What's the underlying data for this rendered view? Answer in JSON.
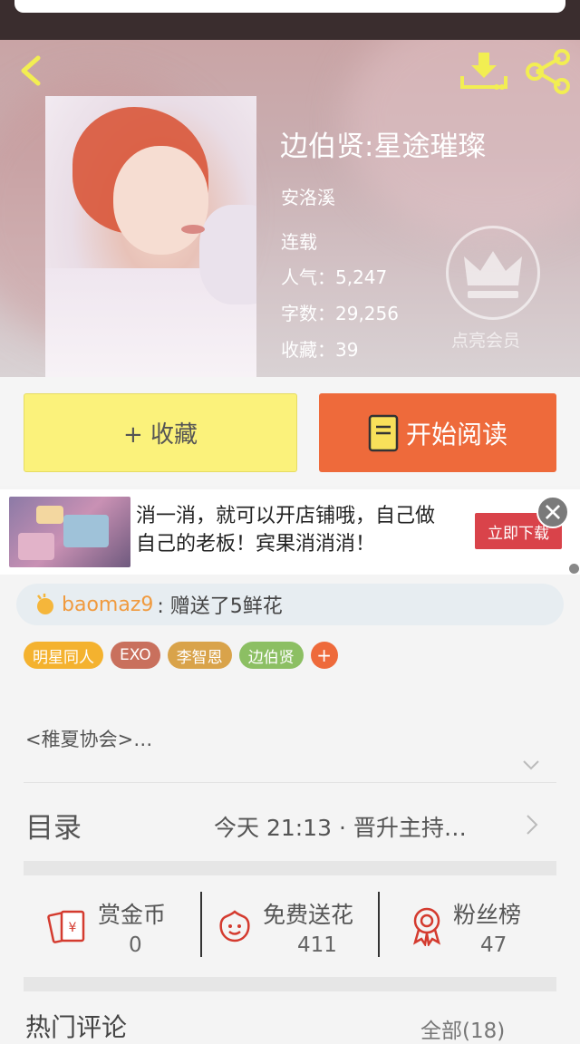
{
  "book": {
    "title": "边伯贤:星途璀璨",
    "author": "安洛溪",
    "status": "连载",
    "popularity_label": "人气：",
    "popularity": "5,247",
    "words_label": "字数：",
    "words": "29,256",
    "favorites_label": "收藏：",
    "favorites": "39"
  },
  "vip": {
    "label": "点亮会员"
  },
  "actions": {
    "collect": "+ 收藏",
    "read": "开始阅读"
  },
  "ad": {
    "text": "消一消，就可以开店铺哦，自己做自己的老板！宾果消消消！",
    "cta": "立即下载"
  },
  "gift": {
    "user": "baomaz9",
    "text": ": 赠送了5鲜花"
  },
  "tags": [
    {
      "label": "明星同人",
      "color": "#f4b22f"
    },
    {
      "label": "EXO",
      "color": "#c9705d"
    },
    {
      "label": "李智恩",
      "color": "#d9a34a"
    },
    {
      "label": "边伯贤",
      "color": "#8cbf63"
    },
    {
      "label": "+",
      "color": "#ee6a3b"
    }
  ],
  "intro": "<稚夏协会>…",
  "toc": {
    "label": "目录",
    "latest": "今天 21:13 · 晋升主持…"
  },
  "metrics": [
    {
      "label": "赏金币",
      "value": "0",
      "icon": "red-envelope-icon"
    },
    {
      "label": "免费送花",
      "value": "411",
      "icon": "flower-icon"
    },
    {
      "label": "粉丝榜",
      "value": "47",
      "icon": "ribbon-medal-icon"
    }
  ],
  "comments": {
    "title": "热门评论",
    "all": "全部(18)"
  }
}
